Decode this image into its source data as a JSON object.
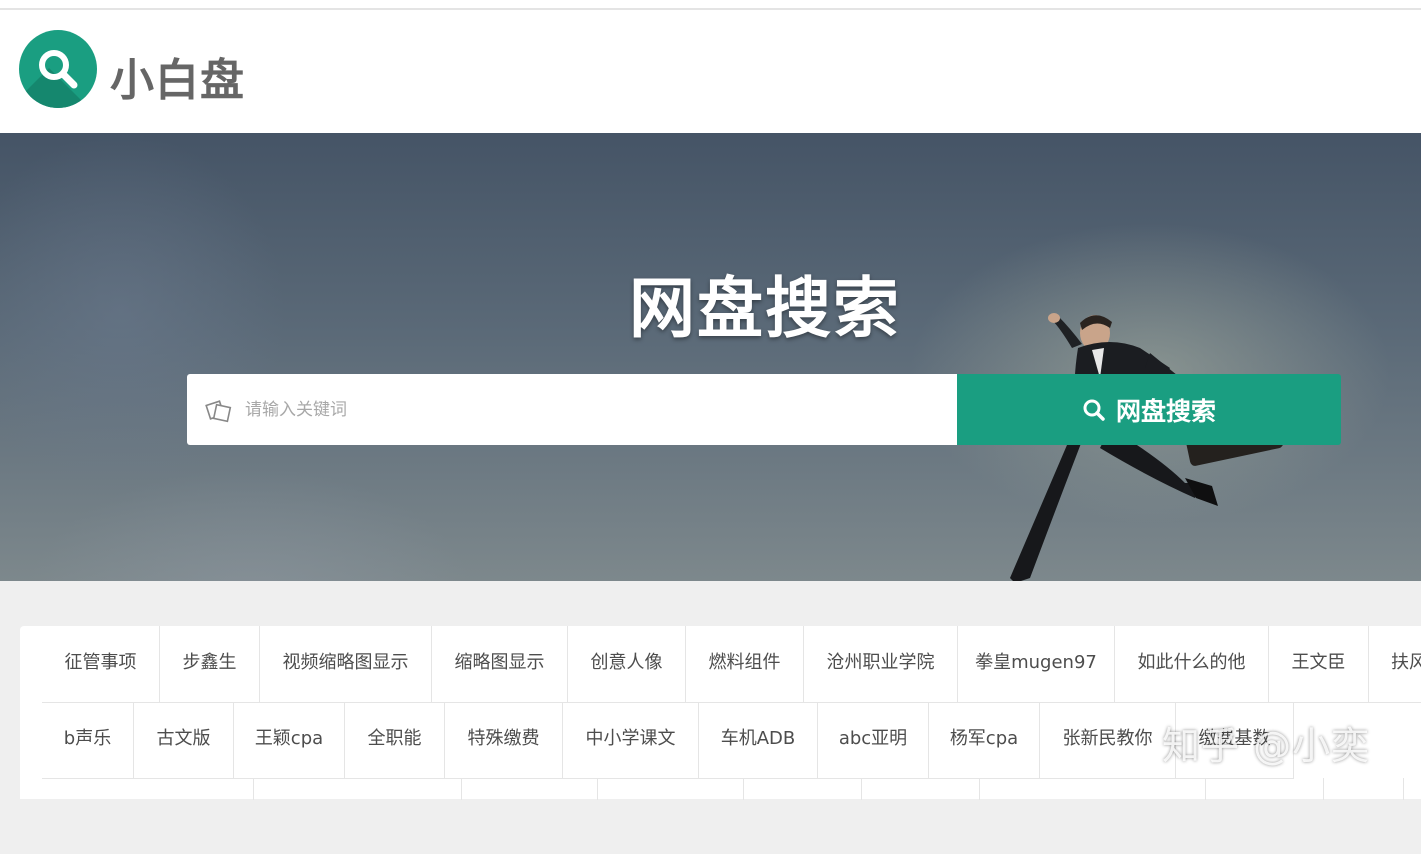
{
  "header": {
    "brand": "小白盘",
    "logo_icon": "magnifier-icon",
    "accent_color": "#1a9e81"
  },
  "hero": {
    "title": "网盘搜索",
    "search": {
      "placeholder": "请输入关键词",
      "value": "",
      "input_icon": "edit-note-icon",
      "button_label": "网盘搜索",
      "button_icon": "search-icon"
    }
  },
  "tags": {
    "row1": [
      "征管事项",
      "步鑫生",
      "视频缩略图显示",
      "缩略图显示",
      "创意人像",
      "燃料组件",
      "沧州职业学院",
      "拳皇mugen97",
      "如此什么的他",
      "王文臣",
      "扶风"
    ],
    "row2": [
      "b声乐",
      "古文版",
      "王颖cpa",
      "全职能",
      "特殊缴费",
      "中小学课文",
      "车机ADB",
      "abc亚明",
      "杨军cpa",
      "张新民教你",
      "缴费基数"
    ]
  },
  "watermark": "知乎 @小奕"
}
